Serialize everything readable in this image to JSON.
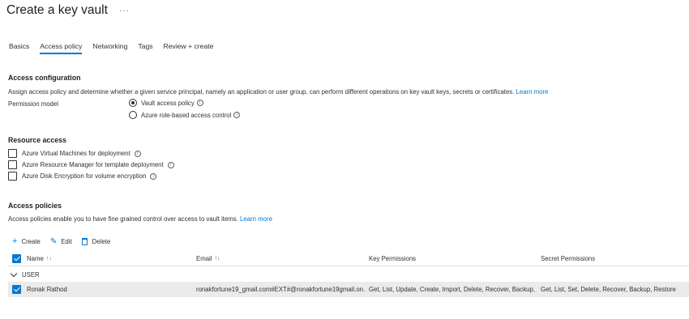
{
  "header": {
    "title": "Create a key vault",
    "more_label": "···"
  },
  "tabs": [
    {
      "label": "Basics",
      "active": false
    },
    {
      "label": "Access policy",
      "active": true
    },
    {
      "label": "Networking",
      "active": false
    },
    {
      "label": "Tags",
      "active": false
    },
    {
      "label": "Review + create",
      "active": false
    }
  ],
  "access_config": {
    "title": "Access configuration",
    "description": "Assign access policy and determine whether a given service principal, namely an application or user group, can perform different operations on key vault keys, secrets or certificates.",
    "learn_more": "Learn more",
    "permission_label": "Permission model",
    "options": [
      {
        "label": "Vault access policy",
        "selected": true
      },
      {
        "label": "Azure role-based access control",
        "selected": false
      }
    ]
  },
  "resource_access": {
    "title": "Resource access",
    "items": [
      {
        "label": "Azure Virtual Machines for deployment",
        "checked": false
      },
      {
        "label": "Azure Resource Manager for template deployment",
        "checked": false
      },
      {
        "label": "Azure Disk Encryption for volume encryption",
        "checked": false
      }
    ]
  },
  "access_policies": {
    "title": "Access policies",
    "description": "Access policies enable you to have fine grained control over access to vault items.",
    "learn_more": "Learn more",
    "toolbar": {
      "create": "Create",
      "edit": "Edit",
      "delete": "Delete"
    },
    "columns": {
      "name": "Name",
      "email": "Email",
      "key_permissions": "Key Permissions",
      "secret_permissions": "Secret Permissions"
    },
    "sort_glyph": "↑↓",
    "group_label": "USER",
    "rows": [
      {
        "name": "Ronak Rathod",
        "email": "ronakfortune19_gmail.com#EXT#@ronakfortune19gmail.on...",
        "key_permissions": "Get, List, Update, Create, Import, Delete, Recover, Backup, R...",
        "secret_permissions": "Get, List, Set, Delete, Recover, Backup, Restore",
        "selected": true
      }
    ]
  },
  "colors": {
    "accent": "#0078d4",
    "selected_row": "#edebe9"
  }
}
